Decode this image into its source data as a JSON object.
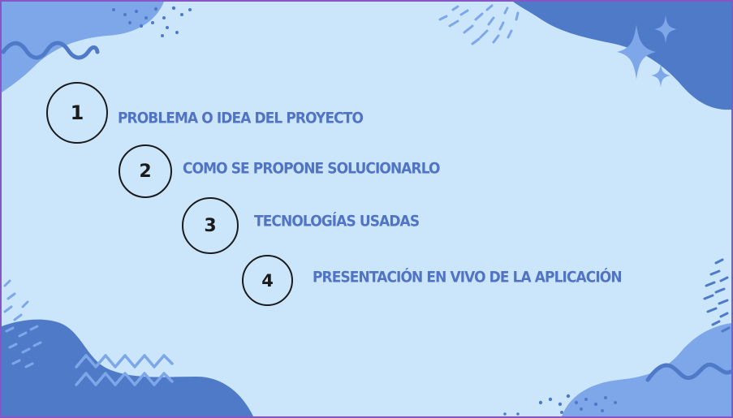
{
  "colors": {
    "background": "#cbe6fb",
    "frame": "#8a54c9",
    "blob_dark": "#4e7ac8",
    "blob_light": "#7ea7ea",
    "accent_text": "#5173c4",
    "circle_stroke": "#1b1b1b"
  },
  "agenda": [
    {
      "number": "1",
      "label": "PROBLEMA O IDEA DEL PROYECTO"
    },
    {
      "number": "2",
      "label": "COMO SE PROPONE SOLUCIONARLO"
    },
    {
      "number": "3",
      "label": "TECNOLOGÍAS USADAS"
    },
    {
      "number": "4",
      "label": "PRESENTACIÓN EN VIVO DE LA APLICACIÓN"
    }
  ],
  "decorations": [
    "wave-squiggle-icon",
    "sparkle-icon",
    "zigzag-icon",
    "dots-pattern"
  ]
}
